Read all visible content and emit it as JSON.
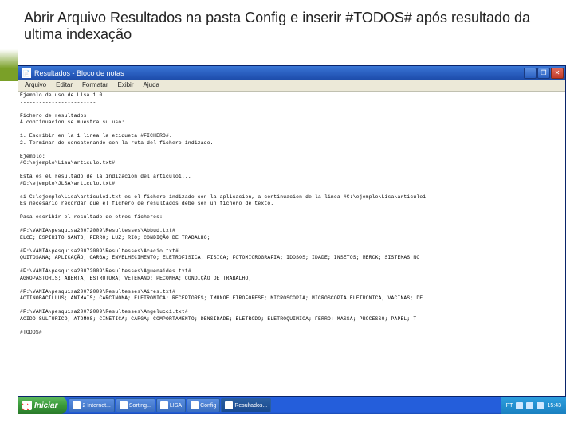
{
  "slide": {
    "title": "Abrir Arquivo Resultados na pasta Config e inserir #TODOS# após resultado da ultima indexação"
  },
  "window": {
    "title": "Resultados - Bloco de notas",
    "menu": {
      "file": "Arquivo",
      "edit": "Editar",
      "format": "Formatar",
      "view": "Exibir",
      "help": "Ajuda"
    },
    "buttons": {
      "min": "_",
      "max": "❐",
      "close": "✕"
    }
  },
  "editor": {
    "content": "Ejemplo de uso de Lisa 1.0\n------------------------\n\nFichero de resultados.\nA continuacion se muestra su uso:\n\n1. Escribir en la 1 linea la etiqueta #FICHERO#.\n2. Terminar de concatenando con la ruta del fichero indizado.\n\nEjemplo:\n#C:\\ejemplo\\Lisa\\articulo.txt#\n\nEsta es el resultado de la indizacion del articulo1...\n#D:\\ejemplo\\JLSA\\articulo.txt#\n\nsi C:\\ejemplo\\Lisa\\articulo1.txt es el fichero indizado con la aplicacion, a continuacion de la linea #C:\\ejemplo\\Lisa\\articulo1\nEs necesario recordar que el fichero de resultados debe ser un fichero de texto.\n\nPasa escribir el resultado de otros ficheros:\n\n#F:\\VANIA\\pesquisa20072009\\Resultesses\\Abbud.txt#\nELCE; ESPIRITO SANTO; FERRO; LUZ; RIO; CONDIÇÃO DE TRABALHO;\n\n#F:\\VANIA\\pesquisa20072009\\Resultesses\\Acacio.txt#\nQUITOSANA; APLICAÇÃO; CARGA; ENVELHECIMENTO; ELETROFISICA; FISICA; FOTOMICROGRAFIA; IDOSOS; IDADE; INSETOS; MERCK; SISTEMAS NO\n\n#F:\\VANIA\\pesquisa20072009\\Resultesses\\Aguenaides.txt#\nAGROPASTORIS; ABERTA; ESTRUTURA; VETERANO; PECONHA; CONDIÇÃO DE TRABALHO;\n\n#F:\\VANIA\\pesquisa20072009\\Resultesses\\Aires.txt#\nACTINOBACILLUS; ANIMAIS; CARCINOMA; ELETRONICA; RECEPTORES; IMUNOELETROFORESE; MICROSCOPIA; MICROSCOPIA ELETRONICA; VACINAS; DE\n\n#F:\\VANIA\\pesquisa20072009\\Resultesses\\Angelucci.txt#\nACIDO SULFURICO; ATOMOS; CINETICA; CARGA; COMPORTAMENTO; DENSIDADE; ELETRODO; ELETROQUIMICA; FERRO; MASSA; PROCESSO; PAPEL; T\n\n#TODOS#\n"
  },
  "taskbar": {
    "start": "Iniciar",
    "items": [
      {
        "label": "2 Internet..."
      },
      {
        "label": "Sorting..."
      },
      {
        "label": "LISA"
      },
      {
        "label": "Config"
      },
      {
        "label": "Resultados..."
      }
    ],
    "tray": {
      "lang": "PT",
      "time": "15:43"
    }
  }
}
